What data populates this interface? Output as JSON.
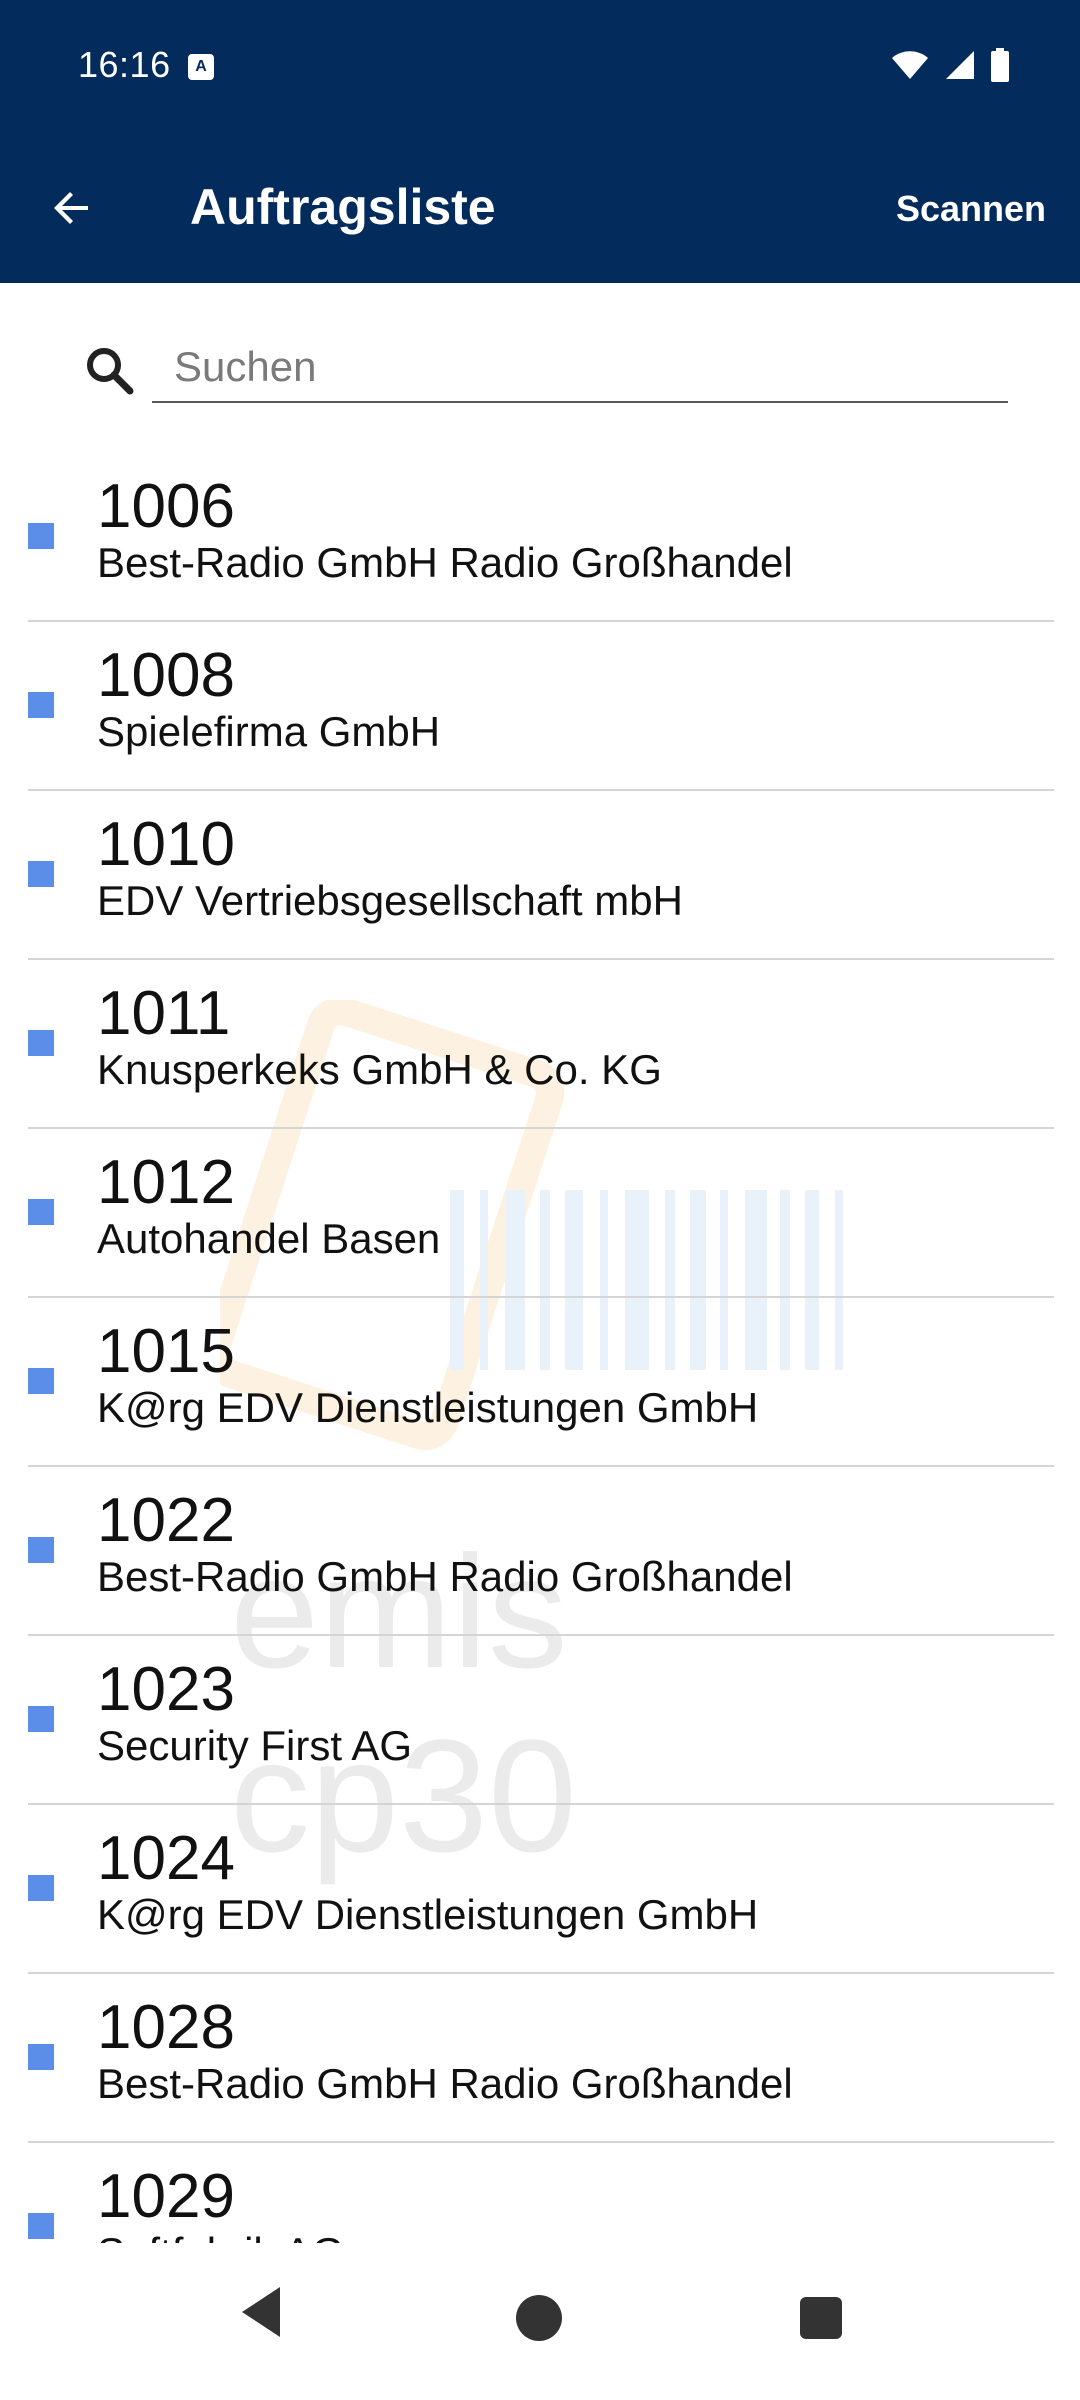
{
  "status_bar": {
    "time": "16:16",
    "notification_icon": "A"
  },
  "app_bar": {
    "title": "Auftragsliste",
    "scan_label": "Scannen"
  },
  "search": {
    "placeholder": "Suchen",
    "value": ""
  },
  "orders": [
    {
      "number": "1006",
      "name": "Best-Radio GmbH Radio Großhandel"
    },
    {
      "number": "1008",
      "name": "Spielefirma GmbH"
    },
    {
      "number": "1010",
      "name": "EDV Vertriebsgesellschaft mbH"
    },
    {
      "number": "1011",
      "name": "Knusperkeks GmbH & Co. KG"
    },
    {
      "number": "1012",
      "name": "Autohandel Basen"
    },
    {
      "number": "1015",
      "name": "K@rg EDV Dienstleistungen GmbH"
    },
    {
      "number": "1022",
      "name": "Best-Radio GmbH Radio Großhandel"
    },
    {
      "number": "1023",
      "name": "Security First AG"
    },
    {
      "number": "1024",
      "name": "K@rg EDV Dienstleistungen GmbH"
    },
    {
      "number": "1028",
      "name": "Best-Radio GmbH Radio Großhandel"
    },
    {
      "number": "1029",
      "name": "Softfabrik AG"
    }
  ],
  "watermark": {
    "text": "emis cp30"
  },
  "colors": {
    "header": "#032b5c",
    "marker": "#5b8ee8"
  },
  "icons": {
    "back": "arrow-left-icon",
    "search": "search-icon",
    "wifi": "wifi-icon",
    "signal": "signal-icon",
    "battery": "battery-icon"
  }
}
